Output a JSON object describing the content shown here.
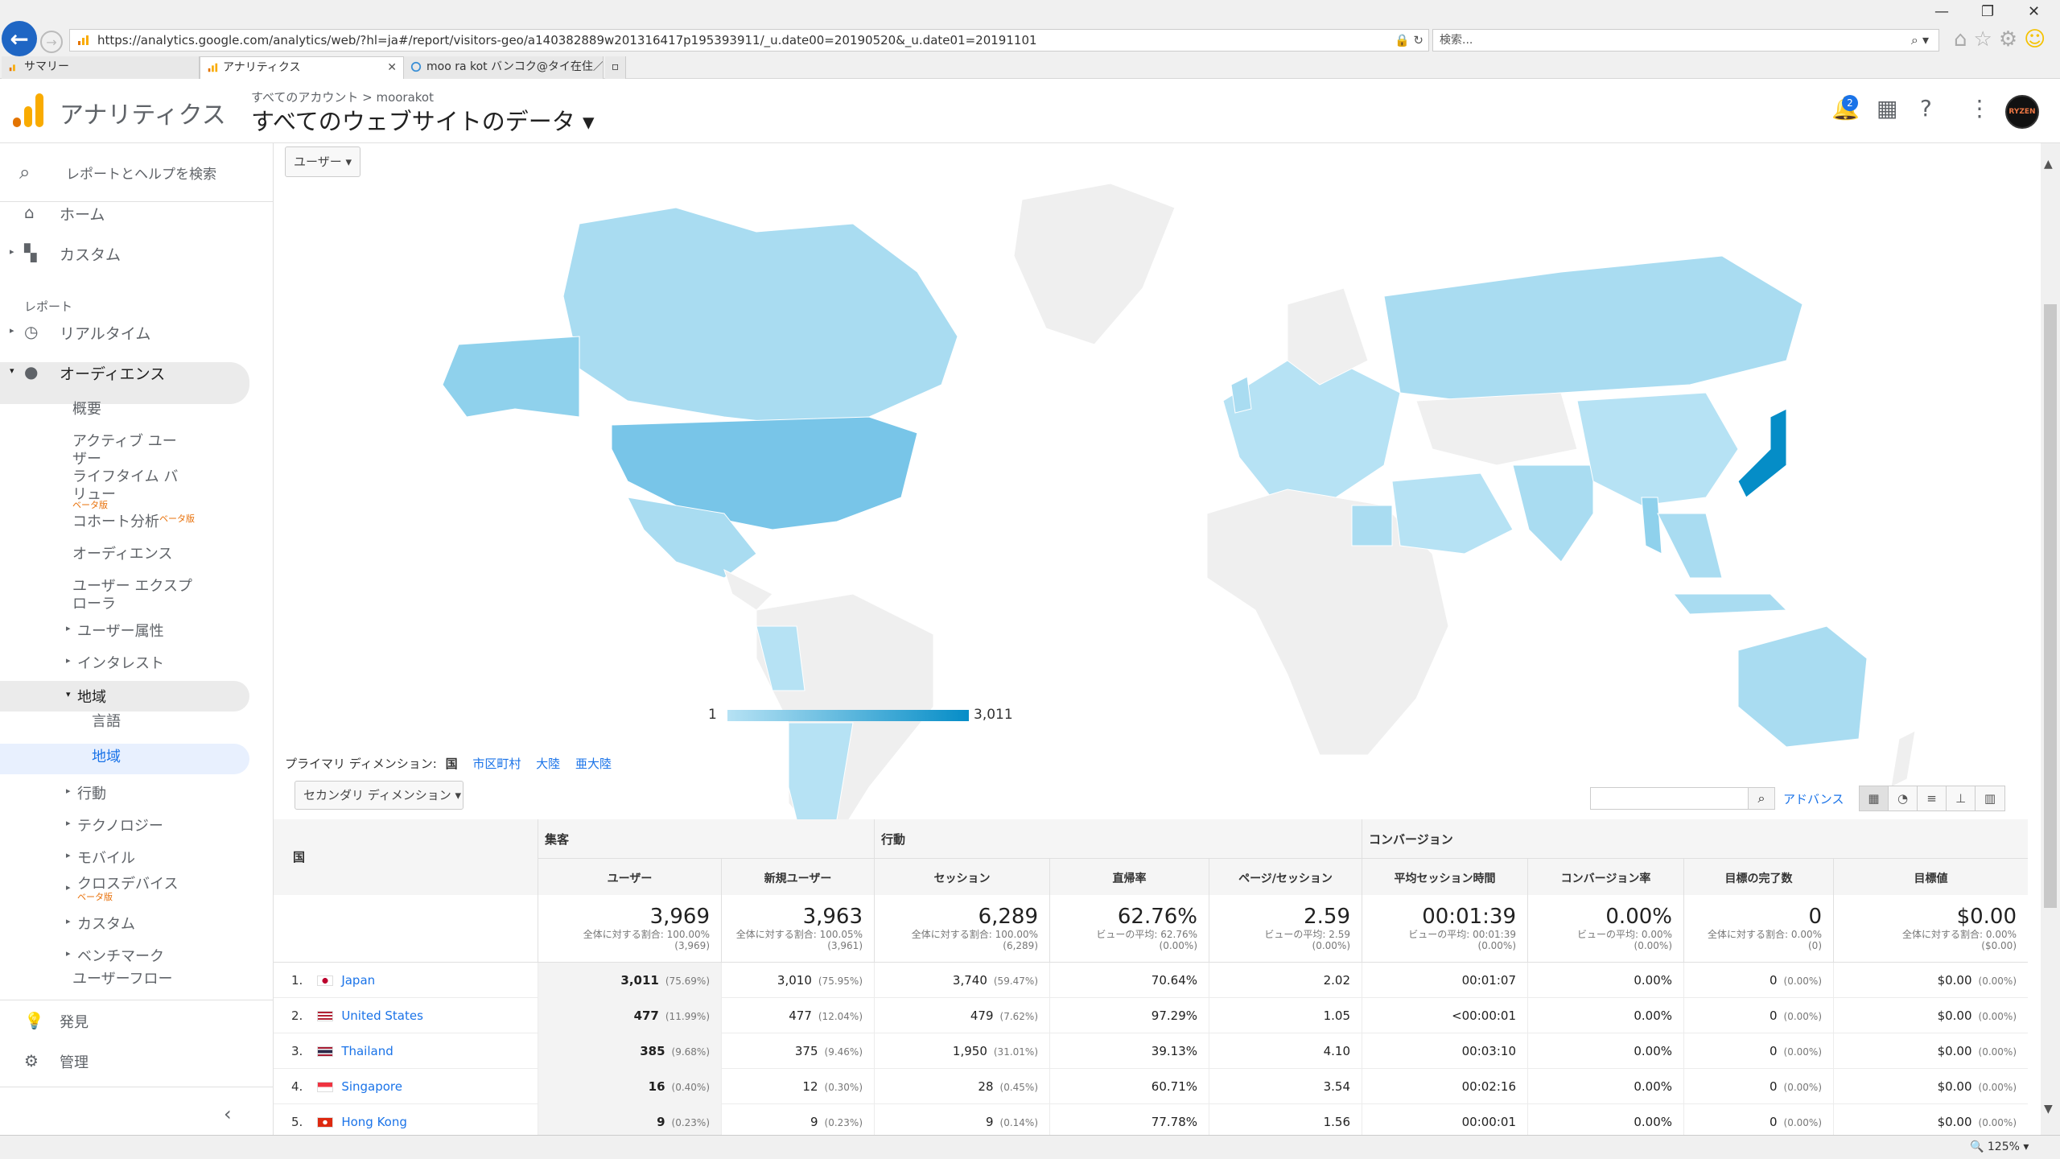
{
  "browser": {
    "url": "https://analytics.google.com/analytics/web/?hl=ja#/report/visitors-geo/a140382889w201316417p195393911/_u.date00=20190520&_u.date01=20191101",
    "search_placeholder": "検索...",
    "tabs": [
      {
        "label": "サマリー"
      },
      {
        "label": "アナリティクス"
      },
      {
        "label": "moo ra kot バンコク@タイ在住／..."
      }
    ],
    "zoom": "125%"
  },
  "header": {
    "app_name": "アナリティクス",
    "account_path": "すべてのアカウント > moorakot",
    "property_name": "すべてのウェブサイトのデータ ▾",
    "notification_count": "2",
    "avatar_text": "RYZEN"
  },
  "sidebar": {
    "search_placeholder": "レポートとヘルプを検索",
    "home": "ホーム",
    "custom": "カスタム",
    "reports_heading": "レポート",
    "realtime": "リアルタイム",
    "audience": "オーディエンス",
    "audience_items": {
      "overview": "概要",
      "active_users": "アクティブ ユー\nザー",
      "lifetime_value": "ライフタイム バ\nリュー",
      "cohort": "コホート分析",
      "audiences": "オーディエンス",
      "user_explorer": "ユーザー エクスプ\nローラ",
      "demographics": "ユーザー属性",
      "interests": "インタレスト",
      "geo": "地域",
      "language": "言語",
      "location": "地域",
      "behavior": "行動",
      "technology": "テクノロジー",
      "mobile": "モバイル",
      "cross_device": "クロスデバイス",
      "custom": "カスタム",
      "benchmark": "ベンチマーク",
      "users_flow": "ユーザーフロー"
    },
    "beta": "ベータ版",
    "discover": "発見",
    "admin": "管理"
  },
  "report": {
    "metric_selector": "ユーザー ▾",
    "legend_min": "1",
    "legend_max": "3,011",
    "primary_dimension_label": "プライマリ ディメンション:",
    "primary_dimension_selected": "国",
    "primary_dimension_options": [
      "市区町村",
      "大陸",
      "亜大陸"
    ],
    "secondary_dimension": "セカンダリ ディメンション ▾",
    "advanced": "アドバンス",
    "groups": {
      "acquisition": "集客",
      "behavior": "行動",
      "conversions": "コンバージョン"
    },
    "dim_header": "国",
    "columns": [
      "ユーザー",
      "新規ユーザー",
      "セッション",
      "直帰率",
      "ページ/セッション",
      "平均セッション時間",
      "コンバージョン率",
      "目標の完了数",
      "目標値"
    ],
    "totals": [
      {
        "v": "3,969",
        "s1": "全体に対する割合: 100.00%",
        "s2": "(3,969)"
      },
      {
        "v": "3,963",
        "s1": "全体に対する割合: 100.05%",
        "s2": "(3,961)"
      },
      {
        "v": "6,289",
        "s1": "全体に対する割合: 100.00%",
        "s2": "(6,289)"
      },
      {
        "v": "62.76%",
        "s1": "ビューの平均: 62.76%",
        "s2": "(0.00%)"
      },
      {
        "v": "2.59",
        "s1": "ビューの平均: 2.59",
        "s2": "(0.00%)"
      },
      {
        "v": "00:01:39",
        "s1": "ビューの平均: 00:01:39",
        "s2": "(0.00%)"
      },
      {
        "v": "0.00%",
        "s1": "ビューの平均: 0.00%",
        "s2": "(0.00%)"
      },
      {
        "v": "0",
        "s1": "全体に対する割合: 0.00%",
        "s2": "(0)"
      },
      {
        "v": "$0.00",
        "s1": "全体に対する割合: 0.00%",
        "s2": "($0.00)"
      }
    ],
    "rows": [
      {
        "n": "1.",
        "country": "Japan",
        "users": "3,011",
        "users_p": "(75.69%)",
        "new": "3,010",
        "new_p": "(75.95%)",
        "sess": "3,740",
        "sess_p": "(59.47%)",
        "bounce": "70.64%",
        "pps": "2.02",
        "dur": "00:01:07",
        "conv": "0.00%",
        "goal": "0",
        "goal_p": "(0.00%)",
        "val": "$0.00",
        "val_p": "(0.00%)"
      },
      {
        "n": "2.",
        "country": "United States",
        "users": "477",
        "users_p": "(11.99%)",
        "new": "477",
        "new_p": "(12.04%)",
        "sess": "479",
        "sess_p": "(7.62%)",
        "bounce": "97.29%",
        "pps": "1.05",
        "dur": "<00:00:01",
        "conv": "0.00%",
        "goal": "0",
        "goal_p": "(0.00%)",
        "val": "$0.00",
        "val_p": "(0.00%)"
      },
      {
        "n": "3.",
        "country": "Thailand",
        "users": "385",
        "users_p": "(9.68%)",
        "new": "375",
        "new_p": "(9.46%)",
        "sess": "1,950",
        "sess_p": "(31.01%)",
        "bounce": "39.13%",
        "pps": "4.10",
        "dur": "00:03:10",
        "conv": "0.00%",
        "goal": "0",
        "goal_p": "(0.00%)",
        "val": "$0.00",
        "val_p": "(0.00%)"
      },
      {
        "n": "4.",
        "country": "Singapore",
        "users": "16",
        "users_p": "(0.40%)",
        "new": "12",
        "new_p": "(0.30%)",
        "sess": "28",
        "sess_p": "(0.45%)",
        "bounce": "60.71%",
        "pps": "3.54",
        "dur": "00:02:16",
        "conv": "0.00%",
        "goal": "0",
        "goal_p": "(0.00%)",
        "val": "$0.00",
        "val_p": "(0.00%)"
      },
      {
        "n": "5.",
        "country": "Hong Kong",
        "users": "9",
        "users_p": "(0.23%)",
        "new": "9",
        "new_p": "(0.23%)",
        "sess": "9",
        "sess_p": "(0.14%)",
        "bounce": "77.78%",
        "pps": "1.56",
        "dur": "00:00:01",
        "conv": "0.00%",
        "goal": "0",
        "goal_p": "(0.00%)",
        "val": "$0.00",
        "val_p": "(0.00%)"
      }
    ]
  },
  "colors": {
    "map_high": "#058dc7",
    "map_low": "#b6e2f4",
    "map_none": "#f0f0f0",
    "link": "#1a73e8",
    "logo_orange": "#f9ab00",
    "logo_dark": "#e37400"
  }
}
